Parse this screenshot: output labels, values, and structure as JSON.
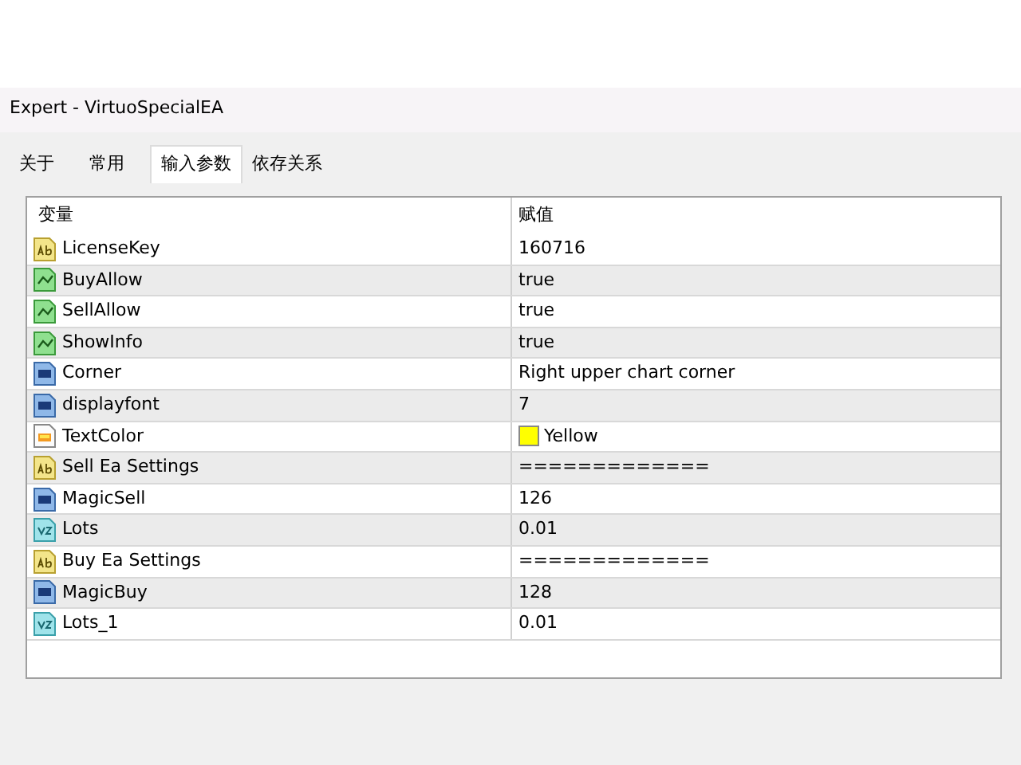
{
  "window": {
    "title": "Expert - VirtuoSpecialEA"
  },
  "tabs": [
    {
      "label": "关于",
      "selected": false
    },
    {
      "label": "常用",
      "selected": false
    },
    {
      "label": "输入参数",
      "selected": true
    },
    {
      "label": "依存关系",
      "selected": false
    }
  ],
  "table": {
    "columns": [
      "变量",
      "赋值"
    ],
    "rows": [
      {
        "kind": "string",
        "name": "LicenseKey",
        "value": "160716"
      },
      {
        "kind": "bool",
        "name": "BuyAllow",
        "value": "true"
      },
      {
        "kind": "bool",
        "name": "SellAllow",
        "value": "true"
      },
      {
        "kind": "bool",
        "name": "ShowInfo",
        "value": "true"
      },
      {
        "kind": "int",
        "name": "Corner",
        "value": "Right upper chart corner"
      },
      {
        "kind": "int",
        "name": "displayfont",
        "value": "7"
      },
      {
        "kind": "color",
        "name": "TextColor",
        "value": "Yellow",
        "color": "#ffff00"
      },
      {
        "kind": "string",
        "name": "Sell Ea Settings",
        "value": "============="
      },
      {
        "kind": "int",
        "name": "MagicSell",
        "value": "126"
      },
      {
        "kind": "double",
        "name": "Lots",
        "value": "0.01"
      },
      {
        "kind": "string",
        "name": "Buy Ea Settings",
        "value": "============="
      },
      {
        "kind": "int",
        "name": "MagicBuy",
        "value": "128"
      },
      {
        "kind": "double",
        "name": "Lots_1",
        "value": "0.01"
      }
    ]
  }
}
